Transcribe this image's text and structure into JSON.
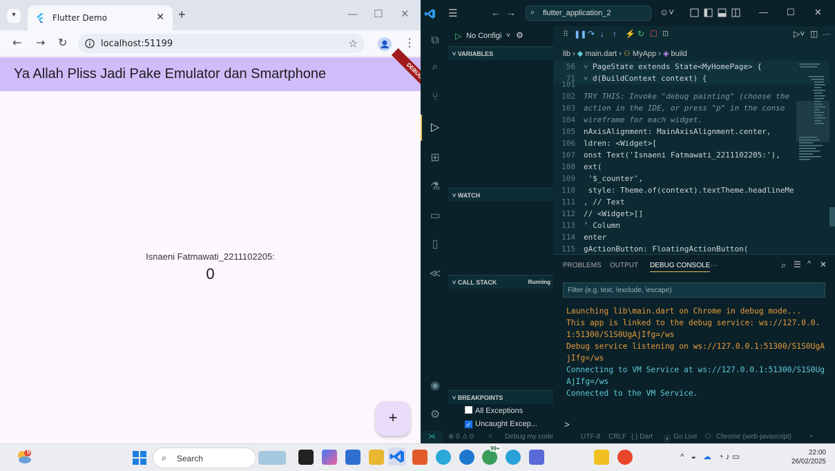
{
  "chrome": {
    "tab_title": "Flutter Demo",
    "tab_close": "✕",
    "new_tab": "+",
    "url": "localhost:51199",
    "window_controls": {
      "minimize": "—",
      "maximize": "☐",
      "close": "✕"
    }
  },
  "flutter_app": {
    "appbar_title": "Ya Allah Pliss Jadi Pake Emulator dan Smartphone",
    "debug_banner": "DEBUG",
    "name_text": "Isnaeni Fatmawati_2211102205:",
    "counter": "0",
    "fab_label": "+"
  },
  "vscode": {
    "search_text": "flutter_application_2",
    "run_config": "No Configi",
    "sections": {
      "variables": "VARIABLES",
      "watch": "WATCH",
      "call_stack": "CALL STACK",
      "call_stack_status": "Running",
      "breakpoints": "BREAKPOINTS"
    },
    "breakpoints": [
      {
        "label": "All Exceptions",
        "checked": false
      },
      {
        "label": "Uncaught Excep...",
        "checked": true
      }
    ],
    "breadcrumb": [
      "lib",
      "main.dart",
      "MyApp",
      "build"
    ],
    "sticky_lines": [
      {
        "num": "56",
        "text": "PageState extends State<MyHomePage> {"
      },
      {
        "num": "71",
        "text": "d(BuildContext context) {"
      }
    ],
    "code_lines": [
      {
        "num": "101",
        "text": ""
      },
      {
        "num": "102",
        "text": "TRY THIS: Invoke \"debug painting\" (choose the"
      },
      {
        "num": "103",
        "text": "action in the IDE, or press \"p\" in the conso"
      },
      {
        "num": "104",
        "text": "wireframe for each widget."
      },
      {
        "num": "105",
        "text": "nAxisAlignment: MainAxisAlignment.center,"
      },
      {
        "num": "106",
        "text": "ldren: <Widget>["
      },
      {
        "num": "107",
        "text": "onst Text('Isnaeni Fatmawati_2211102205:'),"
      },
      {
        "num": "108",
        "text": "ext("
      },
      {
        "num": "109",
        "text": " '$_counter',"
      },
      {
        "num": "110",
        "text": " style: Theme.of(context).textTheme.headlineMe"
      },
      {
        "num": "111",
        "text": ", // Text"
      },
      {
        "num": "112",
        "text": "// <Widget>[]"
      },
      {
        "num": "113",
        "text": "' Column"
      },
      {
        "num": "114",
        "text": "enter"
      },
      {
        "num": "115",
        "text": "gActionButton: FloatingActionButton("
      }
    ],
    "panel_tabs": [
      "PROBLEMS",
      "OUTPUT",
      "DEBUG CONSOLE",
      "···"
    ],
    "active_panel_tab": "DEBUG CONSOLE",
    "filter_placeholder": "Filter (e.g. text, !exclude, \\escape)",
    "console_lines": [
      {
        "text": "Launching lib\\main.dart on Chrome in debug mode...",
        "color": "orange"
      },
      {
        "text": "This app is linked to the debug service: ws://127.0.0.",
        "color": "orange"
      },
      {
        "text": "1:51300/S1S0UgAjIfg=/ws",
        "color": "orange"
      },
      {
        "text": "Debug service listening on ws://127.0.0.1:51300/S1S0UgA",
        "color": "orange"
      },
      {
        "text": "jIfg=/ws",
        "color": "orange"
      },
      {
        "text": "Connecting to VM Service at ws://127.0.0.1:51300/S1S0Ug",
        "color": "cyan"
      },
      {
        "text": "AjIfg=/ws",
        "color": "cyan"
      },
      {
        "text": "Connected to the VM Service.",
        "color": "cyan"
      }
    ],
    "console_prompt": ">",
    "status": {
      "problems": "⊗ 0 ⚠ 0",
      "debug_label": "Debug my code",
      "encoding": "UTF-8",
      "eol": "CRLF",
      "language": "{ } Dart",
      "go_live": "Go Live",
      "device": "Chrome (web-javascript)"
    }
  },
  "taskbar": {
    "weather_badge": "5",
    "search_text": "Search",
    "copilot_badge": "99+",
    "time": "22:00",
    "date": "26/02/2025"
  },
  "colors": {
    "appbar": "#d0bcf9",
    "flutter_bg": "#fdf7fe",
    "vscode_bg": "#0d2a33",
    "console_orange": "#e69b3c",
    "console_cyan": "#5ec9d9"
  }
}
